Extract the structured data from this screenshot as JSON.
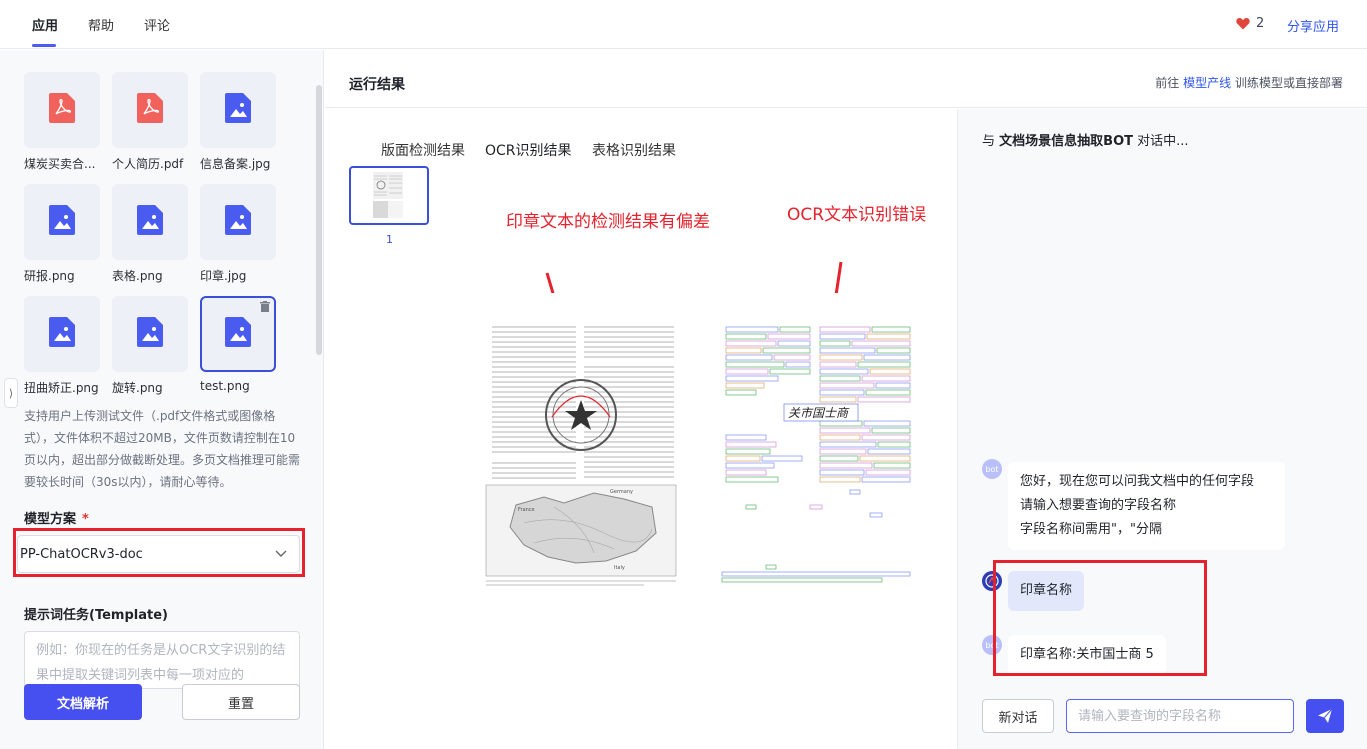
{
  "topbar": {
    "tabs": [
      {
        "label": "应用",
        "active": true
      },
      {
        "label": "帮助",
        "active": false
      },
      {
        "label": "评论",
        "active": false
      }
    ],
    "like_count": "2",
    "share_label": "分享应用"
  },
  "files": [
    {
      "name": "煤炭买卖合...",
      "type": "pdf"
    },
    {
      "name": "个人简历.pdf",
      "type": "pdf"
    },
    {
      "name": "信息备案.jpg",
      "type": "image"
    },
    {
      "name": "研报.png",
      "type": "image"
    },
    {
      "name": "表格.png",
      "type": "image"
    },
    {
      "name": "印章.jpg",
      "type": "image"
    },
    {
      "name": "扭曲矫正.png",
      "type": "image"
    },
    {
      "name": "旋转.png",
      "type": "image"
    },
    {
      "name": "test.png",
      "type": "image",
      "selected": true
    }
  ],
  "upload_hint": "支持用户上传测试文件（.pdf文件格式或图像格式），文件体积不超过20MB，文件页数请控制在10页以内，超出部分做截断处理。多页文档推理可能需要较长时间（30s以内），请耐心等待。",
  "model": {
    "title": "模型方案",
    "required_mark": "*",
    "selected": "PP-ChatOCRv3-doc"
  },
  "template": {
    "title": "提示词任务(Template)",
    "placeholder": "例如：你现在的任务是从OCR文字识别的结果中提取关键词列表中每一项对应的"
  },
  "actions": {
    "parse_label": "文档解析",
    "reset_label": "重置"
  },
  "result": {
    "title": "运行结果",
    "goto_prefix": "前往",
    "goto_link": "模型产线",
    "goto_suffix": "训练模型或直接部署",
    "tabs": [
      "版面检测结果",
      "OCR识别结果",
      "表格识别结果"
    ],
    "active_tab": "OCR识别结果",
    "page_number": "1",
    "annotation_left": "印章文本的检测结果有偏差",
    "annotation_right": "OCR文本识别错误",
    "ocr_text": "关市国士商",
    "map_labels": [
      "France",
      "Germany",
      "Italy"
    ]
  },
  "chat": {
    "title_prefix": "与",
    "bot_name": "文档场景信息抽取BOT",
    "title_suffix": "对话中...",
    "bot_avatar": "bot",
    "messages": [
      {
        "role": "bot",
        "lines": [
          "您好，现在您可以问我文档中的任何字段",
          "请输入想要查询的字段名称",
          "字段名称间需用\"，\"分隔"
        ]
      },
      {
        "role": "user",
        "lines": [
          "印章名称"
        ]
      },
      {
        "role": "bot",
        "lines": [
          "印章名称:关市国士商 5"
        ]
      }
    ],
    "new_chat_label": "新对话",
    "input_placeholder": "请输入要查询的字段名称"
  },
  "colors": {
    "accent": "#4650f0",
    "highlight_red": "#e5222d",
    "pdf_red": "#f2625d",
    "image_blue": "#4a5cf0"
  }
}
